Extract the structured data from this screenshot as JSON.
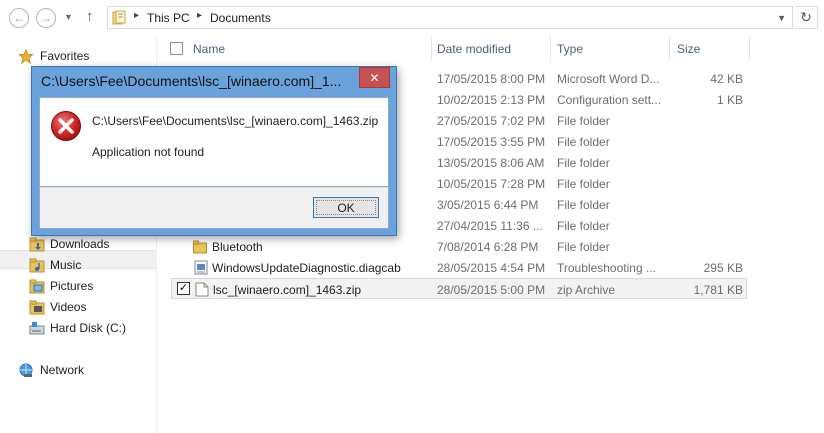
{
  "address_bar": {
    "crumbs": [
      "This PC",
      "Documents"
    ]
  },
  "nav_pane": {
    "items": [
      {
        "label": "Favorites",
        "icon": "star-icon"
      },
      {
        "label": "Downloads",
        "icon": "downloads-folder-icon"
      },
      {
        "label": "Music",
        "icon": "music-folder-icon"
      },
      {
        "label": "Pictures",
        "icon": "pictures-folder-icon"
      },
      {
        "label": "Videos",
        "icon": "videos-folder-icon"
      },
      {
        "label": "Hard Disk (C:)",
        "icon": "drive-icon"
      },
      {
        "label": "Network",
        "icon": "network-icon"
      }
    ]
  },
  "file_list": {
    "columns": {
      "name": "Name",
      "date": "Date modified",
      "type": "Type",
      "size": "Size"
    },
    "rows": [
      {
        "name": "",
        "date": "17/05/2015 8:00 PM",
        "type": "Microsoft Word D...",
        "size": "42 KB",
        "icon": "word-document-icon"
      },
      {
        "name": "",
        "date": "10/02/2015 2:13 PM",
        "type": "Configuration sett...",
        "size": "1 KB",
        "icon": "config-file-icon"
      },
      {
        "name": "",
        "date": "27/05/2015 7:02 PM",
        "type": "File folder",
        "size": "",
        "icon": "folder-icon"
      },
      {
        "name": "",
        "date": "17/05/2015 3:55 PM",
        "type": "File folder",
        "size": "",
        "icon": "folder-icon"
      },
      {
        "name": "",
        "date": "13/05/2015 8:06 AM",
        "type": "File folder",
        "size": "",
        "icon": "folder-icon"
      },
      {
        "name": "",
        "date": "10/05/2015 7:28 PM",
        "type": "File folder",
        "size": "",
        "icon": "folder-icon"
      },
      {
        "name": "",
        "date": "3/05/2015 6:44 PM",
        "type": "File folder",
        "size": "",
        "icon": "folder-icon"
      },
      {
        "name": "",
        "date": "27/04/2015 11:36 ...",
        "type": "File folder",
        "size": "",
        "icon": "folder-icon"
      },
      {
        "name": "Bluetooth",
        "date": "7/08/2014 6:28 PM",
        "type": "File folder",
        "size": "",
        "icon": "folder-icon"
      },
      {
        "name": "WindowsUpdateDiagnostic.diagcab",
        "date": "28/05/2015 4:54 PM",
        "type": "Troubleshooting ...",
        "size": "295 KB",
        "icon": "diagcab-file-icon"
      },
      {
        "name": "lsc_[winaero.com]_1463.zip",
        "date": "28/05/2015 5:00 PM",
        "type": "zip Archive",
        "size": "1,781 KB",
        "icon": "zip-file-icon",
        "checked": true
      }
    ]
  },
  "dialog": {
    "title": "C:\\Users\\Fee\\Documents\\lsc_[winaero.com]_1...",
    "close_label": "✕",
    "path_text": "C:\\Users\\Fee\\Documents\\lsc_[winaero.com]_1463.zip",
    "message": "Application not found",
    "ok_label": "OK",
    "icon": "error-icon"
  },
  "colors": {
    "dialog_frame": "#6aa3dc",
    "close_button": "#c75050",
    "header_text": "#4c607a",
    "folder_yellow": "#e8c35a"
  }
}
